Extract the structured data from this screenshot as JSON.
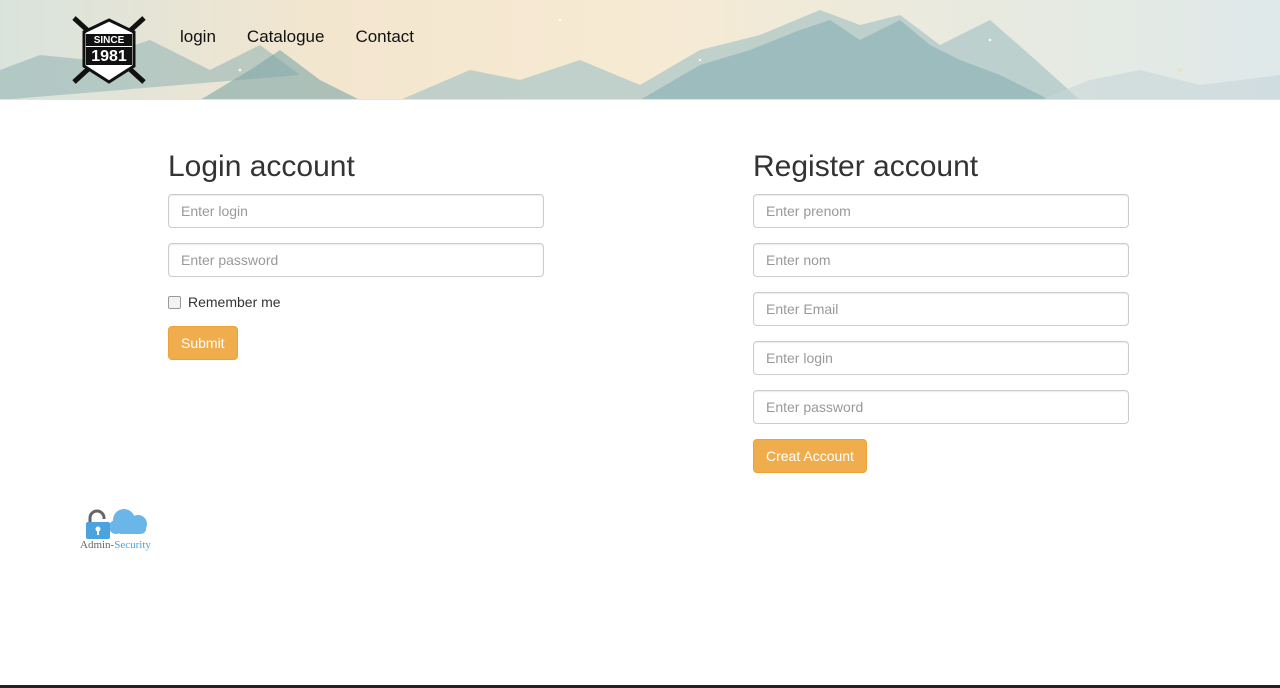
{
  "header": {
    "logo": {
      "text_top": "SINCE",
      "text_main": "1981"
    },
    "nav": [
      {
        "label": "login"
      },
      {
        "label": "Catalogue"
      },
      {
        "label": "Contact"
      }
    ]
  },
  "login": {
    "title": "Login account",
    "login_placeholder": "Enter login",
    "password_placeholder": "Enter password",
    "remember_label": "Remember me",
    "remember_checked": false,
    "submit_label": "Submit"
  },
  "register": {
    "title": "Register account",
    "prenom_placeholder": "Enter prenom",
    "nom_placeholder": "Enter nom",
    "email_placeholder": "Enter Email",
    "login_placeholder": "Enter login",
    "password_placeholder": "Enter password",
    "submit_label": "Creat Account"
  },
  "footer": {
    "admin_logo_part1": "Admin-",
    "admin_logo_part2": "Security"
  },
  "colors": {
    "button": "#f0ad4e",
    "button_border": "#eea236",
    "admin_blue": "#4aa3df"
  },
  "icons": [
    "since-1981-logo",
    "lock-icon",
    "cloud-icon"
  ]
}
